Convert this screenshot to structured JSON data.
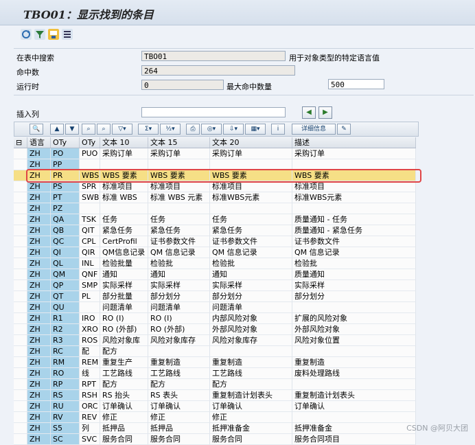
{
  "title": "TBO01：显示找到的条目",
  "toolbar_icons": [
    "refresh-icon",
    "filter-icon",
    "save-icon",
    "list-icon"
  ],
  "form": {
    "search_table_label": "在表中搜索",
    "search_table_value": "TBO01",
    "search_table_desc": "用于对象类型的特定语言值",
    "hits_label": "命中数",
    "hits_value": "264",
    "runtime_label": "运行时",
    "runtime_value": "0",
    "max_hits_label": "最大命中数量",
    "max_hits_value": "500",
    "insert_col_label": "插入列",
    "insert_col_value": ""
  },
  "alv": {
    "detail_label": "详细信息"
  },
  "grid": {
    "columns": [
      "语言",
      "OTy",
      "OTy",
      "文本 10",
      "文本 15",
      "文本 20",
      "描述"
    ],
    "rows": [
      [
        "ZH",
        "PO",
        "PUO",
        "采购订单",
        "采购订单",
        "采购订单",
        "采购订单"
      ],
      [
        "ZH",
        "PP",
        "",
        "",
        "",
        "",
        ""
      ],
      [
        "ZH",
        "PR",
        "WBS",
        "WBS 要素",
        "WBS 要素",
        "WBS 要素",
        "WBS 要素"
      ],
      [
        "ZH",
        "PS",
        "SPR",
        "标准项目",
        "标准项目",
        "标准项目",
        "标准项目"
      ],
      [
        "ZH",
        "PT",
        "SWB",
        "标准 WBS",
        "标准 WBS 元素",
        "标准WBS元素",
        "标准WBS元素"
      ],
      [
        "ZH",
        "PZ",
        "",
        "",
        "",
        "",
        ""
      ],
      [
        "ZH",
        "QA",
        "TSK",
        "任务",
        "任务",
        "任务",
        "质量通知 - 任务"
      ],
      [
        "ZH",
        "QB",
        "QIT",
        "紧急任务",
        "紧急任务",
        "紧急任务",
        "质量通知 - 紧急任务"
      ],
      [
        "ZH",
        "QC",
        "CPL",
        "CertProfil",
        "证书参数文件",
        "证书参数文件",
        "证书参数文件"
      ],
      [
        "ZH",
        "QI",
        "QIR",
        "QM信息记录",
        "QM 信息记录",
        "QM 信息记录",
        "QM 信息记录"
      ],
      [
        "ZH",
        "QL",
        "INL",
        "检验批量",
        "检验批",
        "检验批",
        "检验批"
      ],
      [
        "ZH",
        "QM",
        "QNF",
        "通知",
        "通知",
        "通知",
        "质量通知"
      ],
      [
        "ZH",
        "QP",
        "SMP",
        "实际采样",
        "实际采样",
        "实际采样",
        "实际采样"
      ],
      [
        "ZH",
        "QT",
        "PL",
        "部分批量",
        "部分划分",
        "部分划分",
        "部分划分"
      ],
      [
        "ZH",
        "QU",
        "",
        "问题清单",
        "问题清单",
        "问题清单",
        ""
      ],
      [
        "ZH",
        "R1",
        "IRO",
        "RO (I)",
        "RO (I)",
        "内部风险对象",
        "扩展的风险对象"
      ],
      [
        "ZH",
        "R2",
        "XRO",
        "RO (外部)",
        "RO (外部)",
        "外部风险对象",
        "外部风险对象"
      ],
      [
        "ZH",
        "R3",
        "ROS",
        "风险对象库",
        "风险对象库存",
        "风险对象库存",
        "风险对象位置"
      ],
      [
        "ZH",
        "RC",
        "配",
        "配方",
        "",
        "",
        ""
      ],
      [
        "ZH",
        "RM",
        "REM",
        "重复生产",
        "重复制造",
        "重复制造",
        "重复制造"
      ],
      [
        "ZH",
        "RO",
        "线",
        "工艺路线",
        "工艺路线",
        "工艺路线",
        "废料处理路线"
      ],
      [
        "ZH",
        "RP",
        "RPT",
        "配方",
        "配方",
        "配方",
        ""
      ],
      [
        "ZH",
        "RS",
        "RSH",
        "RS 抬头",
        "RS 表头",
        "重复制造计划表头",
        "重复制造计划表头"
      ],
      [
        "ZH",
        "RU",
        "ORC",
        "订单确认",
        "订单确认",
        "订单确认",
        "订单确认"
      ],
      [
        "ZH",
        "RV",
        "REV",
        "修正",
        "修正",
        "修正",
        ""
      ],
      [
        "ZH",
        "S5",
        "列",
        "抵押品",
        "抵押品",
        "抵押准备金",
        "抵押准备金"
      ],
      [
        "ZH",
        "SC",
        "SVC",
        "服务合同",
        "服务合同",
        "服务合同",
        "服务合同项目"
      ]
    ],
    "selected_row": 2
  },
  "watermark": "CSDN @阿贝大团"
}
